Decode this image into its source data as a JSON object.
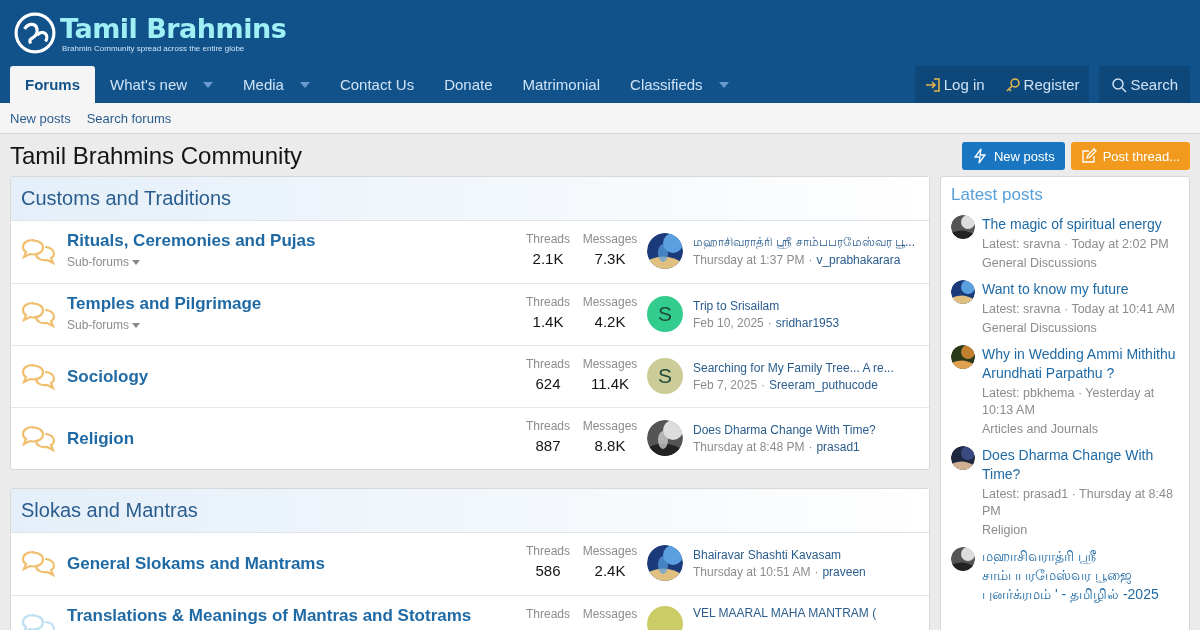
{
  "site": {
    "name": "Tamil Brahmins",
    "tagline": "Brahmin Community spread across the entire globe"
  },
  "nav": [
    {
      "label": "Forums",
      "selected": true,
      "dropdown": false
    },
    {
      "label": "What's new",
      "selected": false,
      "dropdown": true
    },
    {
      "label": "Media",
      "selected": false,
      "dropdown": true
    },
    {
      "label": "Contact Us",
      "selected": false,
      "dropdown": false
    },
    {
      "label": "Donate",
      "selected": false,
      "dropdown": false
    },
    {
      "label": "Matrimonial",
      "selected": false,
      "dropdown": false
    },
    {
      "label": "Classifieds",
      "selected": false,
      "dropdown": true
    }
  ],
  "account": [
    {
      "kind": "login",
      "label": "Log in"
    },
    {
      "kind": "register",
      "label": "Register"
    },
    {
      "kind": "search",
      "label": "Search"
    }
  ],
  "subnav": [
    "New posts",
    "Search forums"
  ],
  "page_title": "Tamil Brahmins Community",
  "actions": [
    {
      "kind": "new",
      "label": "New posts"
    },
    {
      "kind": "post",
      "label": "Post thread..."
    }
  ],
  "categories": [
    {
      "title": "Customs and Traditions",
      "forums": [
        {
          "title": "Rituals, Ceremonies and Pujas",
          "unread": true,
          "subforums": "Sub-forums",
          "threads_label": "Threads",
          "threads": "2.1K",
          "messages_label": "Messages",
          "messages": "7.3K",
          "latest": {
            "title": "மஹாசிவராத்ரி ஸ்ரீ சாம்பபரமேஸ்வர பூ...",
            "date": "Thursday at 1:37 PM",
            "sep": "·",
            "user": "v_prabhakarara"
          }
        },
        {
          "title": "Temples and Pilgrimage",
          "unread": true,
          "subforums": "Sub-forums",
          "threads_label": "Threads",
          "threads": "1.4K",
          "messages_label": "Messages",
          "messages": "4.2K",
          "latest": {
            "avatar": {
              "kind": "letter",
              "letter": "S",
              "color": "#33cc8f"
            },
            "title": "Trip to Srisailam",
            "date": "Feb 10, 2025",
            "sep": "·",
            "user": "sridhar1953"
          }
        },
        {
          "title": "Sociology",
          "unread": true,
          "threads_label": "Threads",
          "threads": "624",
          "messages_label": "Messages",
          "messages": "11.4K",
          "latest": {
            "avatar": {
              "kind": "letter",
              "letter": "S",
              "color": "#cccc99"
            },
            "title": "Searching for My Family Tree... A re...",
            "date": "Feb 7, 2025",
            "sep": "·",
            "user": "Sreeram_puthucode"
          }
        },
        {
          "title": "Religion",
          "unread": true,
          "threads_label": "Threads",
          "threads": "887",
          "messages_label": "Messages",
          "messages": "8.8K",
          "latest": {
            "title": "Does Dharma Change With Time?",
            "date": "Thursday at 8:48 PM",
            "sep": "·",
            "user": "prasad1"
          }
        }
      ]
    },
    {
      "title": "Slokas and Mantras",
      "forums": [
        {
          "title": "General Slokams and Mantrams",
          "unread": true,
          "threads_label": "Threads",
          "threads": "586",
          "messages_label": "Messages",
          "messages": "2.4K",
          "latest": {
            "title": "Bhairavar Shashti Kavasam",
            "date": "Thursday at 10:51 AM",
            "sep": "·",
            "user": "praveen"
          }
        },
        {
          "title": "Translations & Meanings of Mantras and Stotrams",
          "unread": false,
          "threads_label": "Threads",
          "messages_label": "Messages",
          "latest": {
            "avatar": {
              "kind": "letter",
              "color": "#cccc66"
            },
            "title": "VEL MAARAL MAHA MANTRAM ("
          }
        }
      ]
    }
  ],
  "sidebar": {
    "title": "Latest posts",
    "posts": [
      {
        "title": "The magic of spiritual energy",
        "meta": "Latest: sravna · Today at 2:02 PM",
        "forum": "General Discussions"
      },
      {
        "title": "Want to know my future",
        "meta": "Latest: sravna · Today at 10:41 AM",
        "forum": "General Discussions"
      },
      {
        "title": "Why in Wedding Ammi Mithithu Arundhati Parpathu ?",
        "meta": "Latest: pbkhema · Yesterday at 10:13 AM",
        "forum": "Articles and Journals"
      },
      {
        "title": "Does Dharma Change With Time?",
        "meta": "Latest: prasad1 · Thursday at 8:48 PM",
        "forum": "Religion"
      },
      {
        "title": "மஹாசிவராத்ரி ஸ்ரீ சாம்பபரமேஸ்வர பூஜை புனர்க்ரமம் ' - தமிழில் -2025"
      }
    ]
  }
}
